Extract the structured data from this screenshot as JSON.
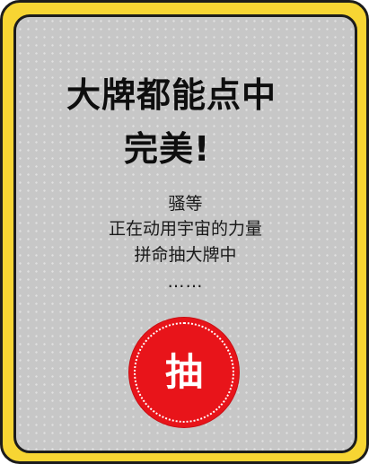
{
  "headline": {
    "line1": "大牌都能点中",
    "line2": "完美!"
  },
  "message": {
    "line1": "骚等",
    "line2": "正在动用宇宙的力量",
    "line3": "拼命抽大牌中",
    "line4": "……"
  },
  "draw_button": {
    "label": "抽"
  },
  "colors": {
    "frame": "#f7d533",
    "card": "#c7c7c7",
    "button": "#e8141a",
    "border": "#1c1c1c"
  }
}
